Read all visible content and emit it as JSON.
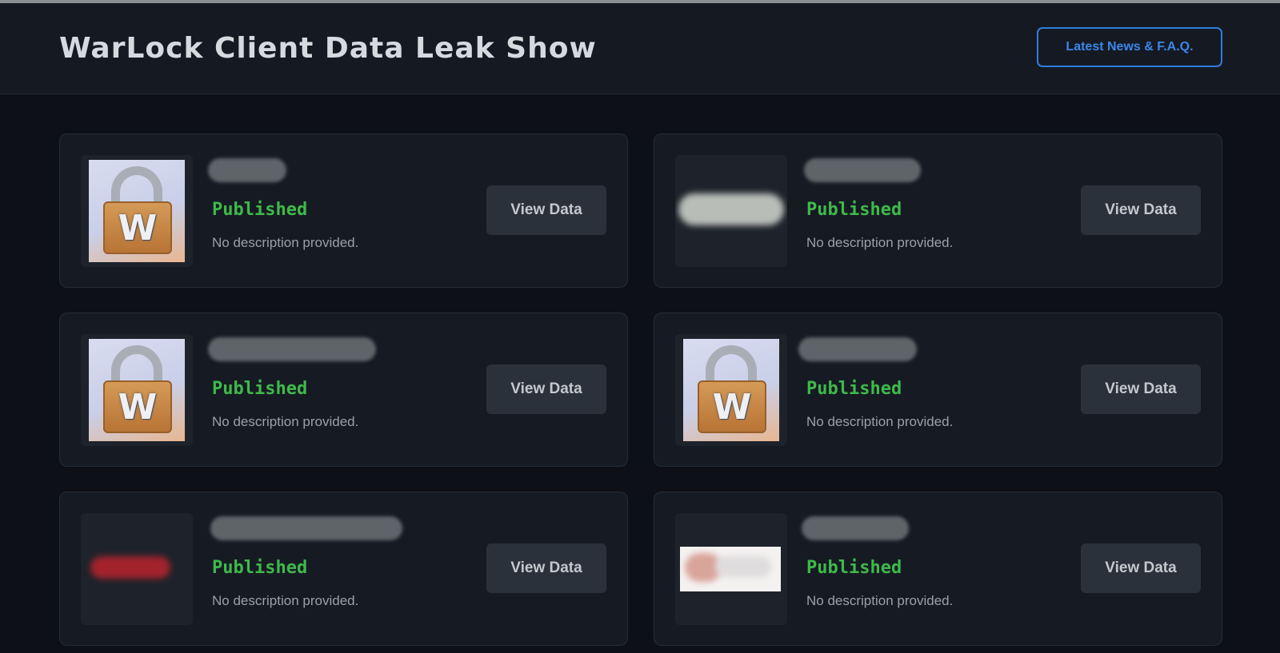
{
  "header": {
    "title": "WarLock Client Data Leak Show",
    "nav_button": "Latest News & F.A.Q."
  },
  "cards": [
    {
      "status": "Published",
      "description": "No description provided.",
      "button": "View Data",
      "image": "lock-logo"
    },
    {
      "status": "Published",
      "description": "No description provided.",
      "button": "View Data",
      "image": "redacted-logo"
    },
    {
      "status": "Published",
      "description": "No description provided.",
      "button": "View Data",
      "image": "lock-logo"
    },
    {
      "status": "Published",
      "description": "No description provided.",
      "button": "View Data",
      "image": "lock-logo"
    },
    {
      "status": "Published",
      "description": "No description provided.",
      "button": "View Data",
      "image": "redacted-logo"
    },
    {
      "status": "Published",
      "description": "No description provided.",
      "button": "View Data",
      "image": "redacted-logo"
    }
  ],
  "lock_logo_letter": "W",
  "colors": {
    "status_published": "#3fb94a",
    "accent": "#2f7de1",
    "background": "#0d1016"
  }
}
